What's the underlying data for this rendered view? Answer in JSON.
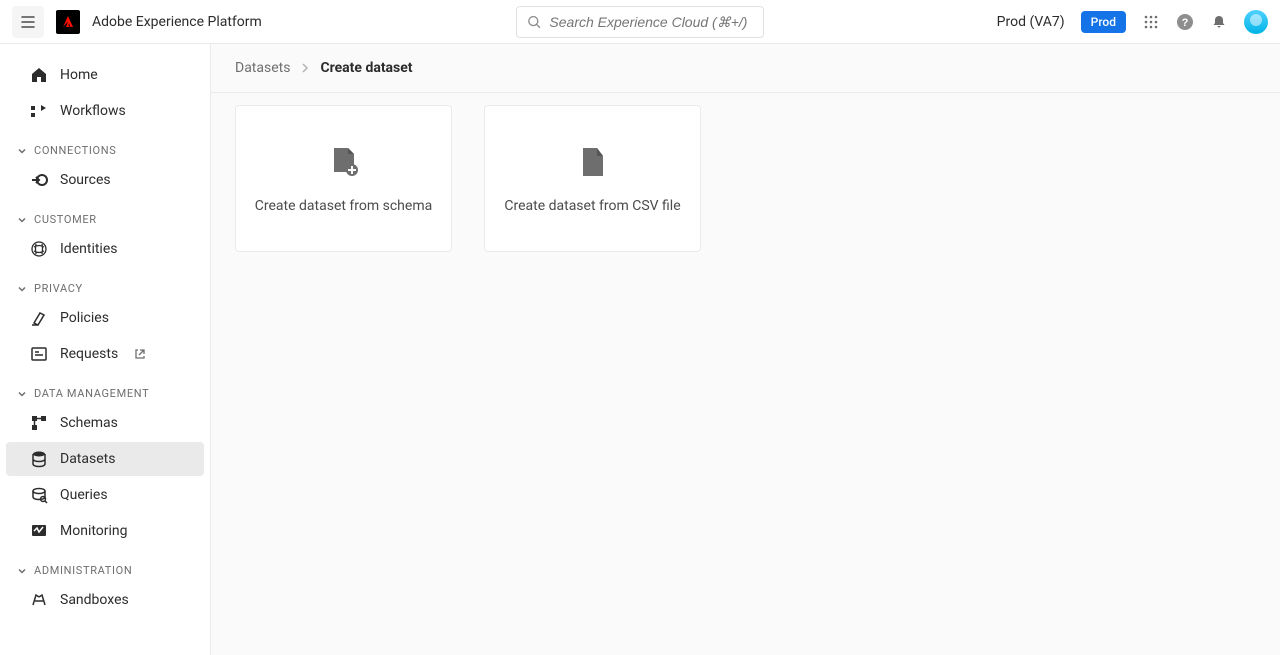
{
  "header": {
    "app_title": "Adobe Experience Platform",
    "search_placeholder": "Search Experience Cloud (⌘+/)",
    "env_label": "Prod (VA7)",
    "prod_badge": "Prod"
  },
  "sidebar": {
    "top": [
      {
        "label": "Home"
      },
      {
        "label": "Workflows"
      }
    ],
    "sections": [
      {
        "title": "CONNECTIONS",
        "items": [
          {
            "label": "Sources"
          }
        ]
      },
      {
        "title": "CUSTOMER",
        "items": [
          {
            "label": "Identities"
          }
        ]
      },
      {
        "title": "PRIVACY",
        "items": [
          {
            "label": "Policies"
          },
          {
            "label": "Requests",
            "external": true
          }
        ]
      },
      {
        "title": "DATA MANAGEMENT",
        "items": [
          {
            "label": "Schemas"
          },
          {
            "label": "Datasets",
            "active": true
          },
          {
            "label": "Queries"
          },
          {
            "label": "Monitoring"
          }
        ]
      },
      {
        "title": "ADMINISTRATION",
        "items": [
          {
            "label": "Sandboxes"
          }
        ]
      }
    ]
  },
  "breadcrumb": {
    "root": "Datasets",
    "current": "Create dataset"
  },
  "cards": [
    {
      "label": "Create dataset from schema"
    },
    {
      "label": "Create dataset from CSV file"
    }
  ]
}
